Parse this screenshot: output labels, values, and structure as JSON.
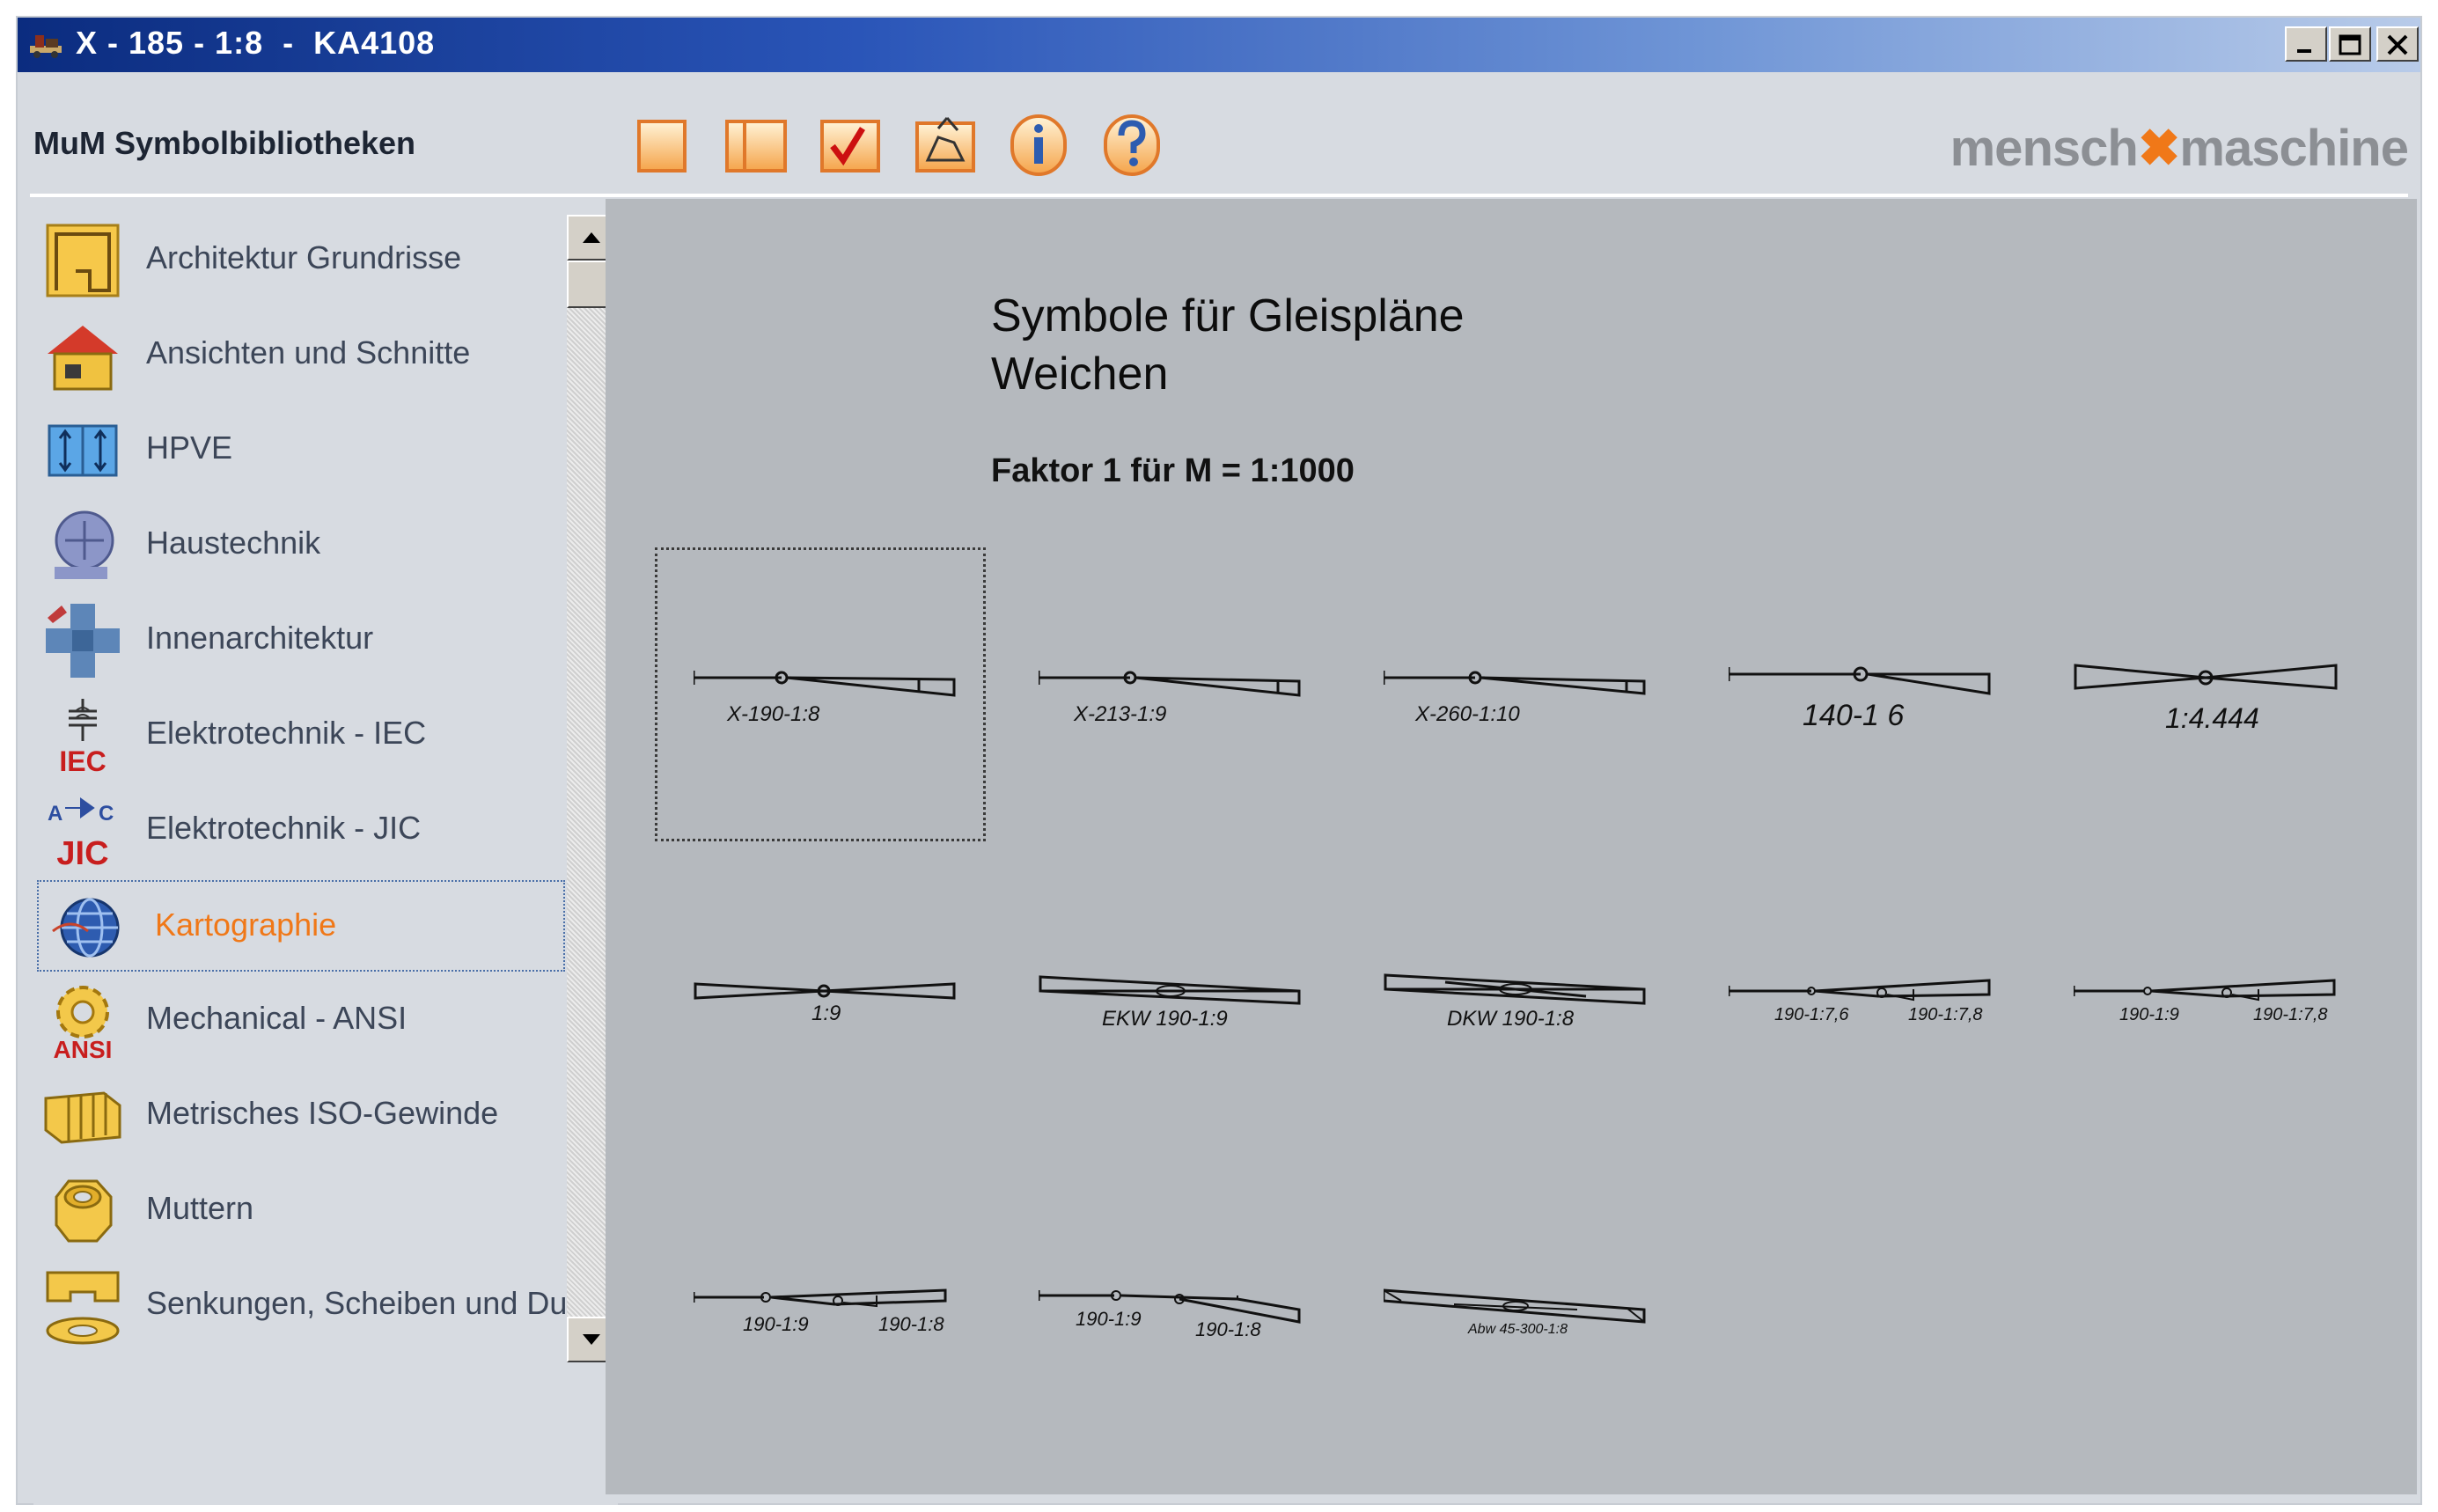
{
  "window": {
    "title": "X - 185 - 1:8  -  KA4108",
    "controls": [
      "minimize",
      "maximize",
      "close"
    ]
  },
  "toolbar": {
    "library_title": "MuM Symbolbibliotheken",
    "buttons": [
      {
        "name": "new-icon"
      },
      {
        "name": "open-icon"
      },
      {
        "name": "check-icon"
      },
      {
        "name": "insert-icon"
      },
      {
        "name": "info-icon"
      },
      {
        "name": "help-icon"
      }
    ],
    "brand": {
      "left": "mensch",
      "right": "maschine"
    },
    "accent": "#f07818"
  },
  "sidebar": {
    "items": [
      {
        "label": "Architektur Grundrisse",
        "icon": "floorplan-icon"
      },
      {
        "label": "Ansichten und Schnitte",
        "icon": "house-icon"
      },
      {
        "label": "HPVE",
        "icon": "hpve-icon"
      },
      {
        "label": "Haustechnik",
        "icon": "hvac-icon"
      },
      {
        "label": "Innenarchitektur",
        "icon": "interior-icon"
      },
      {
        "label": "Elektrotechnik - IEC",
        "icon": "iec-icon",
        "icon_text": "IEC"
      },
      {
        "label": "Elektrotechnik - JIC",
        "icon": "jic-icon",
        "icon_text": "JIC"
      },
      {
        "label": "Kartographie",
        "icon": "globe-icon",
        "active": true
      },
      {
        "label": "Mechanical - ANSI",
        "icon": "ansi-gear-icon",
        "icon_text": "ANSI"
      },
      {
        "label": "Metrisches ISO-Gewinde",
        "icon": "thread-icon"
      },
      {
        "label": "Muttern",
        "icon": "nut-icon"
      },
      {
        "label": "Senkungen, Scheiben und Du",
        "icon": "washer-icon"
      }
    ]
  },
  "main": {
    "heading_line1": "Symbole für Gleispläne",
    "heading_line2": "Weichen",
    "factor": "Faktor 1 für M = 1:1000",
    "symbols": [
      {
        "caption": "X-190-1:8"
      },
      {
        "caption": "X-213-1:9"
      },
      {
        "caption": "X-260-1:10"
      },
      {
        "caption": "140-1 6"
      },
      {
        "caption": "1:4.444"
      },
      {
        "caption": "1:9"
      },
      {
        "caption": "EKW 190-1:9"
      },
      {
        "caption": "DKW 190-1:8"
      },
      {
        "caption_a": "190-1:7,6",
        "caption_b": "190-1:7,8"
      },
      {
        "caption_a": "190-1:9",
        "caption_b": "190-1:7,8"
      },
      {
        "caption_a": "190-1:9",
        "caption_b": "190-1:8"
      },
      {
        "caption_a": "190-1:9",
        "caption_b": "190-1:8"
      },
      {
        "caption": "Abw 45-300-1:8"
      }
    ]
  }
}
